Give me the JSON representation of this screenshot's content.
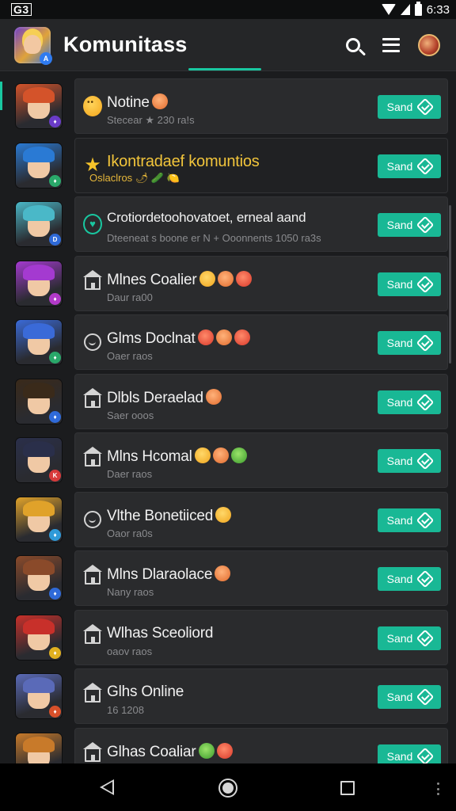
{
  "status_bar": {
    "left": "G3",
    "time": "6:33"
  },
  "app_bar": {
    "title": "Komunitass",
    "logo_badge": "A"
  },
  "rows": [
    {
      "title": "Notine",
      "subtitle": "Stecear ★ 230 ra!s",
      "button": "Sand",
      "badge": "♦",
      "hair": "#d4532a",
      "badge_color": "#6a3cc8",
      "lead": "emoji",
      "style": "normal"
    },
    {
      "title": "Ikontradaef komuntios",
      "subtitle": "Oslaclros 🌶 🥒 🍋",
      "button": "Sand",
      "badge": "♦",
      "hair": "#2a7ad4",
      "badge_color": "#2aa86a",
      "lead": "star",
      "style": "gold"
    },
    {
      "title": "Crotiordetoohovatoet, erneal aand",
      "subtitle": "Dteeneat s boone er N + Ooonnents 1050 ra3s",
      "button": "Sand",
      "badge": "D",
      "hair": "#4ab8c8",
      "badge_color": "#2f6ad8",
      "lead": "heart",
      "style": "small"
    },
    {
      "title": "Mlnes Coalier",
      "subtitle": "Daur ra00",
      "button": "Sand",
      "badge": "♦",
      "hair": "#a43ad0",
      "badge_color": "#b23ac8",
      "lead": "home",
      "style": "normal"
    },
    {
      "title": "Glms Doclnat",
      "subtitle": "Oaer raos",
      "button": "Sand",
      "badge": "♦",
      "hair": "#3a6ad8",
      "badge_color": "#2aa86a",
      "lead": "smile",
      "style": "normal"
    },
    {
      "title": "Dlbls Deraelad",
      "subtitle": "Saer ooos",
      "button": "Sand",
      "badge": "♦",
      "hair": "#3a2a1a",
      "badge_color": "#2f6ad8",
      "lead": "home",
      "style": "normal"
    },
    {
      "title": "Mlns Hcomal",
      "subtitle": "Daer raos",
      "button": "Sand",
      "badge": "K",
      "hair": "#2a2f4a",
      "badge_color": "#d83a3a",
      "lead": "home",
      "style": "normal"
    },
    {
      "title": "Vlthe Bonetiiced",
      "subtitle": "Oaor ra0s",
      "button": "Sand",
      "badge": "♦",
      "hair": "#e0a22a",
      "badge_color": "#2f9ad8",
      "lead": "smile",
      "style": "normal"
    },
    {
      "title": "Mlns Dlaraolace",
      "subtitle": "Nany raos",
      "button": "Sand",
      "badge": "♦",
      "hair": "#8a4a2a",
      "badge_color": "#2f6ad8",
      "lead": "home",
      "style": "normal"
    },
    {
      "title": "Wlhas Sceoliord",
      "subtitle": "oaov raos",
      "button": "Sand",
      "badge": "♦",
      "hair": "#c8302a",
      "badge_color": "#e0b020",
      "lead": "home",
      "style": "normal"
    },
    {
      "title": "Glhs Online",
      "subtitle": "16 1208",
      "button": "Sand",
      "badge": "♦",
      "hair": "#5a6ab8",
      "badge_color": "#d8502a",
      "lead": "home",
      "style": "normal"
    },
    {
      "title": "Glhas Coaliar",
      "subtitle": "",
      "button": "Sand",
      "badge": "♦",
      "hair": "#c87a2a",
      "badge_color": "#2f6ad8",
      "lead": "home",
      "style": "normal"
    }
  ]
}
